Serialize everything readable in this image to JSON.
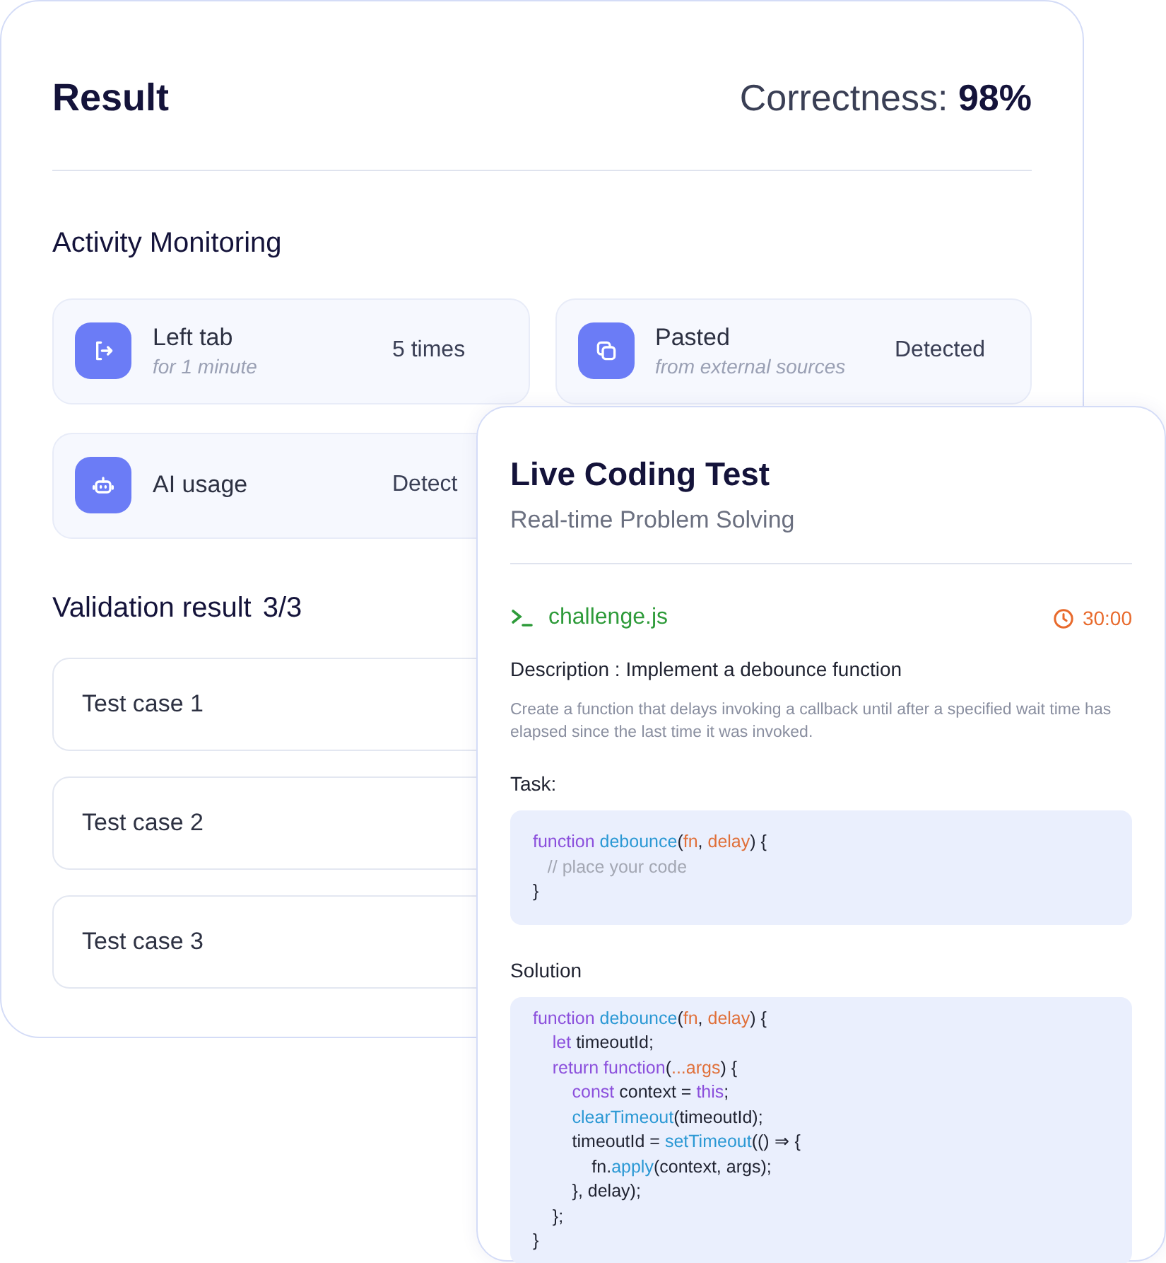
{
  "result_card": {
    "title": "Result",
    "score_label": "Correctness:",
    "score_value": "98%",
    "activity_title": "Activity Monitoring",
    "activities": [
      {
        "kind": "leave",
        "label": "Left tab",
        "detail": "for 1 minute",
        "value": "5 times"
      },
      {
        "kind": "paste",
        "label": "Pasted",
        "detail": "from external sources",
        "value": "Detected"
      },
      {
        "kind": "bot",
        "label": "AI usage",
        "value": "Detect"
      }
    ],
    "validation_title": "Validation result",
    "validation_count": "3/3",
    "test_cases": [
      "Test case 1",
      "Test case 2",
      "Test case 3"
    ]
  },
  "coding_card": {
    "title": "Live Coding Test",
    "subtitle": "Real-time Problem Solving",
    "file_name": "challenge.js",
    "timer": "30:00",
    "description_heading": "Description : Implement a debounce function",
    "description": "Create a function that delays invoking a callback until after a specified wait time has elapsed since the last time it was invoked.",
    "task_label": "Task:",
    "task_code": [
      [
        {
          "kind": "keyword",
          "text": "function "
        },
        {
          "kind": "fn",
          "text": "debounce"
        },
        {
          "kind": "plain",
          "text": "("
        },
        {
          "kind": "param",
          "text": "fn"
        },
        {
          "kind": "plain",
          "text": ", "
        },
        {
          "kind": "param",
          "text": "delay"
        },
        {
          "kind": "plain",
          "text": ") {"
        }
      ],
      [
        {
          "kind": "comment",
          "text": "   // place your code"
        }
      ],
      [
        {
          "kind": "plain",
          "text": "}"
        }
      ]
    ],
    "solution_label": "Solution",
    "solution_code": [
      [
        {
          "kind": "keyword",
          "text": "function "
        },
        {
          "kind": "fn",
          "text": "debounce"
        },
        {
          "kind": "plain",
          "text": "("
        },
        {
          "kind": "param",
          "text": "fn"
        },
        {
          "kind": "plain",
          "text": ", "
        },
        {
          "kind": "param",
          "text": "delay"
        },
        {
          "kind": "plain",
          "text": ") {"
        }
      ],
      [
        {
          "kind": "keyword",
          "text": "    let"
        },
        {
          "kind": "plain",
          "text": " timeoutId;"
        }
      ],
      [
        {
          "kind": "keyword",
          "text": "    return function"
        },
        {
          "kind": "plain",
          "text": "("
        },
        {
          "kind": "param",
          "text": "...args"
        },
        {
          "kind": "plain",
          "text": ") {"
        }
      ],
      [
        {
          "kind": "keyword",
          "text": "        const"
        },
        {
          "kind": "plain",
          "text": " context = "
        },
        {
          "kind": "keyword",
          "text": "this"
        },
        {
          "kind": "plain",
          "text": ";"
        }
      ],
      [
        {
          "kind": "fn",
          "text": "        clearTimeout"
        },
        {
          "kind": "plain",
          "text": "(timeoutId);"
        }
      ],
      [
        {
          "kind": "plain",
          "text": "        timeoutId = "
        },
        {
          "kind": "fn",
          "text": "setTimeout"
        },
        {
          "kind": "plain",
          "text": "(() ⇒ {"
        }
      ],
      [
        {
          "kind": "plain",
          "text": "            fn."
        },
        {
          "kind": "fn",
          "text": "apply"
        },
        {
          "kind": "plain",
          "text": "(context, args);"
        }
      ],
      [
        {
          "kind": "plain",
          "text": "        }, delay);"
        }
      ],
      [
        {
          "kind": "plain",
          "text": "    };"
        }
      ],
      [
        {
          "kind": "plain",
          "text": "}"
        }
      ]
    ]
  }
}
